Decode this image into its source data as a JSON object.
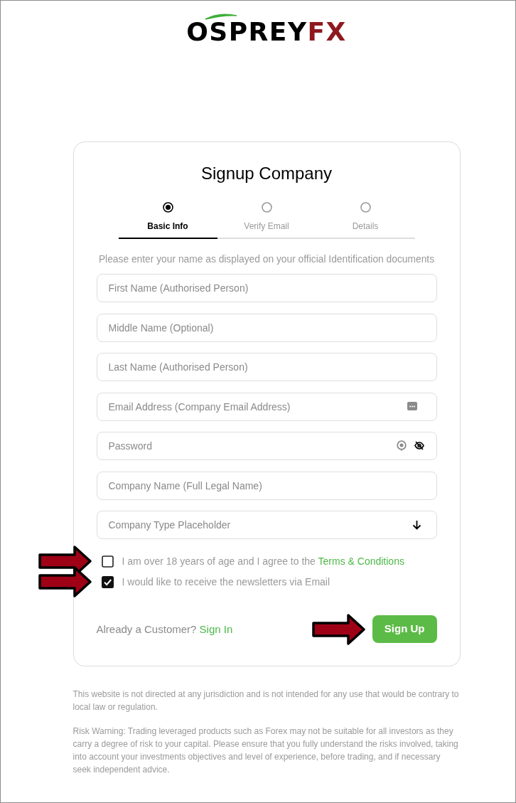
{
  "logo": {
    "text": "OSPREY",
    "accent": "FX"
  },
  "form": {
    "title": "Signup Company",
    "steps": [
      {
        "label": "Basic Info",
        "selected": true
      },
      {
        "label": "Verify Email",
        "selected": false
      },
      {
        "label": "Details",
        "selected": false
      }
    ],
    "instruction": "Please enter your name as displayed on your official Identification documents",
    "fields": [
      {
        "kind": "text",
        "placeholder": "First Name (Authorised Person)"
      },
      {
        "kind": "text",
        "placeholder": "Middle Name (Optional)"
      },
      {
        "kind": "text",
        "placeholder": "Last Name (Authorised Person)"
      },
      {
        "kind": "email",
        "placeholder": "Email Address (Company Email Address)"
      },
      {
        "kind": "password",
        "placeholder": "Password"
      },
      {
        "kind": "text",
        "placeholder": "Company Name (Full Legal Name)"
      },
      {
        "kind": "select",
        "placeholder": "Company Type Placeholder"
      }
    ],
    "agreements": [
      {
        "text": "I am over 18 years of age and I agree to the",
        "link": "Terms & Conditions",
        "checked": false,
        "pointer_arrow": true
      },
      {
        "text": "I would like to receive the newsletters via Email",
        "checked": true,
        "pointer_arrow": true
      }
    ],
    "sign_in": {
      "text": "Already a Customer?",
      "link": "Sign In"
    },
    "submit": {
      "label": "Sign Up",
      "pointer_arrow": true
    }
  },
  "footer": [
    "This website is not directed at any jurisdiction and is not intended for any use that would be contrary to local law or regulation.",
    "Risk Warning: Trading leveraged products such as Forex may not be suitable for all investors as they carry a degree of risk to your capital. Please ensure that you fully understand the risks involved, taking into account your investments objectives and level of experience, before trading, and if necessary seek independent advice."
  ]
}
